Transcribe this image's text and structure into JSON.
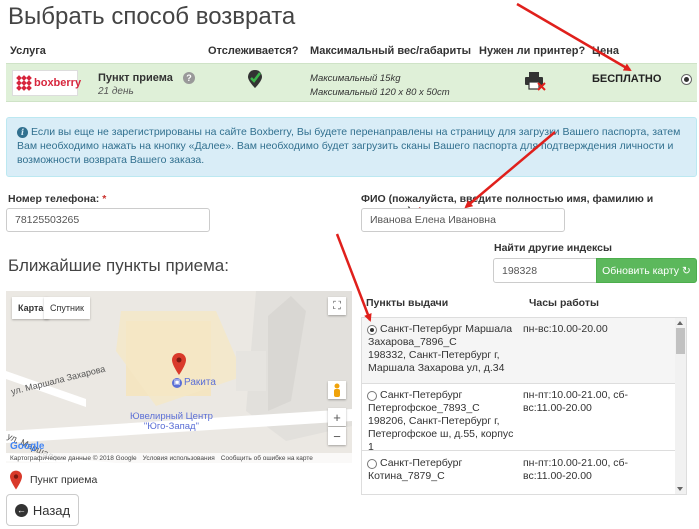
{
  "page": {
    "title": "Выбрать способ возврата"
  },
  "services": {
    "headers": {
      "service": "Услуга",
      "tracked": "Отслеживается?",
      "max_size": "Максимальный вес/габариты",
      "printer": "Нужен ли принтер?",
      "price": "Цена"
    },
    "row": {
      "logo": "boxberry",
      "name": "Пункт приема",
      "days": "21 день",
      "help": "?",
      "weight": "Максимальный 15kg",
      "dimensions": "Максимальный 120 x 80 x 50cm",
      "price": "БЕСПЛАТНО"
    }
  },
  "info": {
    "icon": "i",
    "text": "Если вы еще не зарегистрированы на сайте Boxberry, Вы будете перенаправлены на страницу для загрузки Вашего паспорта, затем Вам необходимо нажать на кнопку «Далее». Вам необходимо будет загрузить сканы Вашего паспорта для подтверждения личности и возможности возврата Вашего заказа."
  },
  "form": {
    "phone_label": "Номер телефона:",
    "phone_value": "78125503265",
    "name_label": "ФИО (пожалуйста, введите полностью имя, фамилию и отчество):",
    "name_value": "Иванова Елена Ивановна",
    "required_mark": "*"
  },
  "nearest": {
    "title": "Ближайшие пункты приема:",
    "search_label": "Найти другие индексы",
    "search_value": "198328",
    "refresh_label": "Обновить карту"
  },
  "map": {
    "tab_map": "Карта",
    "tab_sat": "Спутник",
    "place_name": "Ракита",
    "street1": "ул. Маршала Захарова",
    "street2": "ул. Маршала",
    "jewelry1": "Ювелирный Центр",
    "jewelry2": "\"Юго-Запад\"",
    "zoom_in": "+",
    "zoom_out": "−",
    "footer_provider": "Google",
    "footer_data": "Картографические данные © 2018 Google",
    "footer_terms": "Условия использования",
    "footer_report": "Сообщить об ошибке на карте"
  },
  "legend": {
    "label": "Пункт приема"
  },
  "back_button": "Назад",
  "points": {
    "head_name": "Пункты выдачи",
    "head_hours": "Часы работы",
    "items": [
      {
        "l1": "Санкт-Петербург Маршала",
        "l2": "Захарова_7896_С",
        "l3": "198332, Санкт-Петербург г,",
        "l4": "Маршала Захарова ул, д.34",
        "h1": "пн-вс:10.00-20.00",
        "h2": ""
      },
      {
        "l1": "Санкт-Петербург",
        "l2": "Петергофское_7893_С",
        "l3": "198206, Санкт-Петербург г,",
        "l4": "Петергофское ш, д.55, корпус 1",
        "h1": "пн-пт:10.00-21.00, сб-",
        "h2": "вс:11.00-20.00"
      },
      {
        "l1": "Санкт-Петербург",
        "l2": "Котина_7879_С",
        "l3": "",
        "l4": "",
        "h1": "пн-пт:10.00-21.00, сб-",
        "h2": "вс:11.00-20.00"
      }
    ]
  },
  "colors": {
    "service_row_bg": "#dff0d8",
    "info_bg": "#d9edf7",
    "refresh_button": "#5cb85c",
    "annotation_arrow": "#e0201c",
    "brand": "#d7263d"
  }
}
